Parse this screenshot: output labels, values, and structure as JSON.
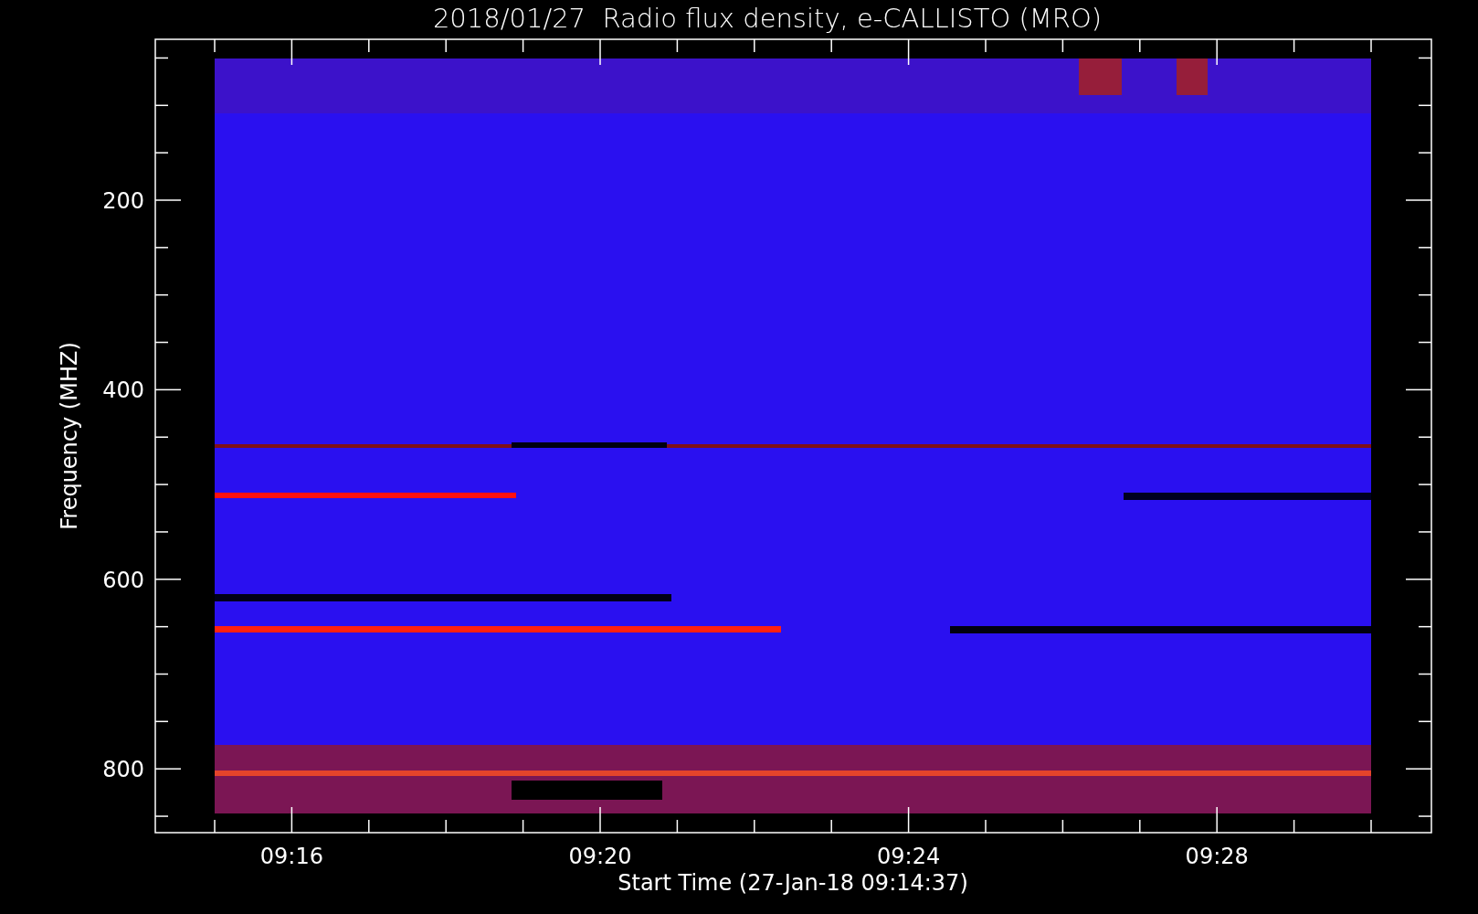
{
  "title": "2018/01/27  Radio flux density, e-CALLISTO (MRO)",
  "plot": {
    "ylabel": "Frequency (MHZ)",
    "xlabel": "Start Time (27-Jan-18 09:14:37)",
    "yticks": [
      "200",
      "400",
      "600",
      "800"
    ],
    "xticks": [
      "09:16",
      "09:20",
      "09:24",
      "09:28"
    ]
  }
}
